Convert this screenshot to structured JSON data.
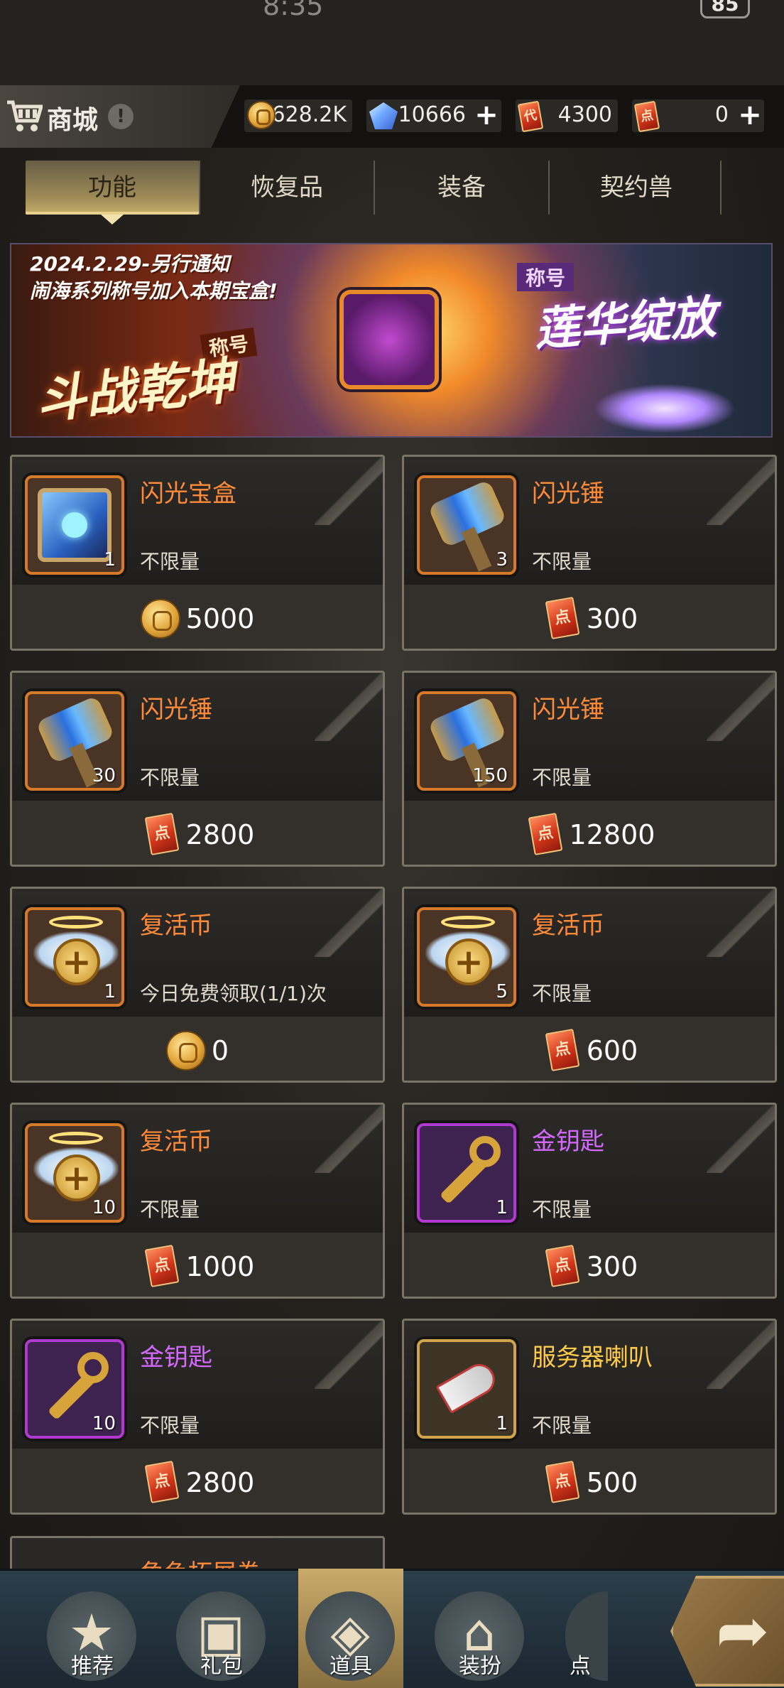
{
  "status": {
    "time": "8:35",
    "battery": "85"
  },
  "header": {
    "title": "商城",
    "info": "!",
    "currencies": [
      {
        "icon": "gold-coin-icon",
        "value": "628.2K"
      },
      {
        "icon": "crystal-icon",
        "value": "10666",
        "plus": "+"
      },
      {
        "icon": "voucher-icon",
        "value": "4300"
      },
      {
        "icon": "point-ticket-icon",
        "value": "0",
        "plus": "+"
      }
    ]
  },
  "tabs": [
    {
      "label": "功能",
      "active": true
    },
    {
      "label": "恢复品"
    },
    {
      "label": "装备"
    },
    {
      "label": "契约兽"
    }
  ],
  "banner": {
    "line1": "2024.2.29-另行通知",
    "line2": "闹海系列称号加入本期宝盒!",
    "tag_left": "称号",
    "title_left": "斗战乾坤",
    "tag_right": "称号",
    "title_right": "莲华绽放"
  },
  "items": [
    {
      "name": "闪光宝盒",
      "qty": "1",
      "limit": "不限量",
      "price_icon": "gold-coin-icon",
      "price": "5000",
      "name_color": "orange"
    },
    {
      "name": "闪光锤",
      "qty": "3",
      "limit": "不限量",
      "price_icon": "point-ticket-icon",
      "price": "300",
      "name_color": "orange"
    },
    {
      "name": "闪光锤",
      "qty": "30",
      "limit": "不限量",
      "price_icon": "point-ticket-icon",
      "price": "2800",
      "name_color": "orange"
    },
    {
      "name": "闪光锤",
      "qty": "150",
      "limit": "不限量",
      "price_icon": "point-ticket-icon",
      "price": "12800",
      "name_color": "orange"
    },
    {
      "name": "复活币",
      "qty": "1",
      "limit": "今日免费领取(1/1)次",
      "price_icon": "gold-coin-icon",
      "price": "0",
      "name_color": "orange"
    },
    {
      "name": "复活币",
      "qty": "5",
      "limit": "不限量",
      "price_icon": "point-ticket-icon",
      "price": "600",
      "name_color": "orange"
    },
    {
      "name": "复活币",
      "qty": "10",
      "limit": "不限量",
      "price_icon": "point-ticket-icon",
      "price": "1000",
      "name_color": "orange"
    },
    {
      "name": "金钥匙",
      "qty": "1",
      "limit": "不限量",
      "price_icon": "point-ticket-icon",
      "price": "300",
      "name_color": "purple"
    },
    {
      "name": "金钥匙",
      "qty": "10",
      "limit": "不限量",
      "price_icon": "point-ticket-icon",
      "price": "2800",
      "name_color": "purple"
    },
    {
      "name": "服务器喇叭",
      "qty": "1",
      "limit": "不限量",
      "price_icon": "point-ticket-icon",
      "price": "500",
      "name_color": "gold"
    }
  ],
  "partial_item": {
    "name": "角色拓展卷"
  },
  "nav": [
    {
      "label": "推荐",
      "icon": "star-icon"
    },
    {
      "label": "礼包",
      "icon": "gift-icon"
    },
    {
      "label": "道具",
      "icon": "item-icon",
      "active": true
    },
    {
      "label": "装扮",
      "icon": "hanger-icon"
    },
    {
      "label": "点",
      "icon": "point-ticket-icon"
    }
  ],
  "ticket_glyph": "点",
  "voucher_glyph": "代",
  "colors": {
    "accent_gold": "#c7ae6a",
    "name_orange": "#ff8a3a",
    "name_purple": "#d468ff",
    "name_gold": "#ffcb4a"
  }
}
